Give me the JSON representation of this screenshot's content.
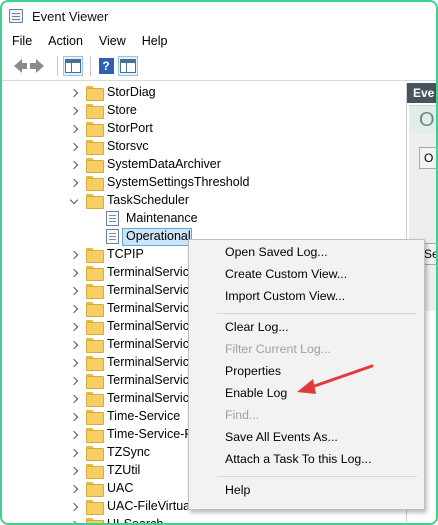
{
  "window": {
    "title": "Event Viewer"
  },
  "menubar": [
    "File",
    "Action",
    "View",
    "Help"
  ],
  "toolbar": {
    "buttons": [
      "back-icon",
      "forward-icon",
      "show-hide-console-tree-icon",
      "help-icon",
      "show-hide-action-pane-icon"
    ],
    "help_glyph": "?"
  },
  "tree": {
    "items": [
      {
        "label": "StorDiag",
        "expanded": false,
        "type": "folder"
      },
      {
        "label": "Store",
        "expanded": false,
        "type": "folder"
      },
      {
        "label": "StorPort",
        "expanded": false,
        "type": "folder"
      },
      {
        "label": "Storsvc",
        "expanded": false,
        "type": "folder"
      },
      {
        "label": "SystemDataArchiver",
        "expanded": false,
        "type": "folder"
      },
      {
        "label": "SystemSettingsThreshold",
        "expanded": false,
        "type": "folder"
      },
      {
        "label": "TaskScheduler",
        "expanded": true,
        "type": "folder"
      },
      {
        "label": "Maintenance",
        "type": "log"
      },
      {
        "label": "Operational",
        "type": "log",
        "selected": true
      },
      {
        "label": "TCPIP",
        "expanded": false,
        "type": "folder"
      },
      {
        "label": "TerminalServices",
        "expanded": false,
        "type": "folder"
      },
      {
        "label": "TerminalServices",
        "expanded": false,
        "type": "folder"
      },
      {
        "label": "TerminalServices",
        "expanded": false,
        "type": "folder"
      },
      {
        "label": "TerminalServices",
        "expanded": false,
        "type": "folder"
      },
      {
        "label": "TerminalServices",
        "expanded": false,
        "type": "folder"
      },
      {
        "label": "TerminalServices",
        "expanded": false,
        "type": "folder"
      },
      {
        "label": "TerminalServices",
        "expanded": false,
        "type": "folder"
      },
      {
        "label": "TerminalServices",
        "expanded": false,
        "type": "folder"
      },
      {
        "label": "Time-Service",
        "expanded": false,
        "type": "folder"
      },
      {
        "label": "Time-Service-P",
        "expanded": false,
        "type": "folder"
      },
      {
        "label": "TZSync",
        "expanded": false,
        "type": "folder"
      },
      {
        "label": "TZUtil",
        "expanded": false,
        "type": "folder"
      },
      {
        "label": "UAC",
        "expanded": false,
        "type": "folder"
      },
      {
        "label": "UAC-FileVirtualization",
        "expanded": false,
        "type": "folder"
      },
      {
        "label": "UI-Search",
        "expanded": false,
        "type": "folder"
      }
    ]
  },
  "right_pane": {
    "header": "Eve",
    "subheader": "O",
    "buttons": [
      "O",
      "Se"
    ]
  },
  "context_menu": {
    "items": [
      {
        "label": "Open Saved Log...",
        "disabled": false
      },
      {
        "label": "Create Custom View...",
        "disabled": false
      },
      {
        "label": "Import Custom View...",
        "disabled": false
      },
      {
        "separator": true
      },
      {
        "label": "Clear Log...",
        "disabled": false
      },
      {
        "label": "Filter Current Log...",
        "disabled": true
      },
      {
        "label": "Properties",
        "disabled": false
      },
      {
        "label": "Enable Log",
        "disabled": false,
        "highlighted_by_arrow": true
      },
      {
        "label": "Find...",
        "disabled": true
      },
      {
        "label": "Save All Events As...",
        "disabled": false
      },
      {
        "label": "Attach a Task To this Log...",
        "disabled": false
      },
      {
        "separator": true
      },
      {
        "label": "Help",
        "disabled": false
      }
    ]
  },
  "colors": {
    "window_border": "#3fcf8e",
    "selection_fill": "#cce4f7",
    "selection_border": "#6aa6dc",
    "annotation_arrow": "#e0393e",
    "right_pane_header": "#49535c"
  }
}
